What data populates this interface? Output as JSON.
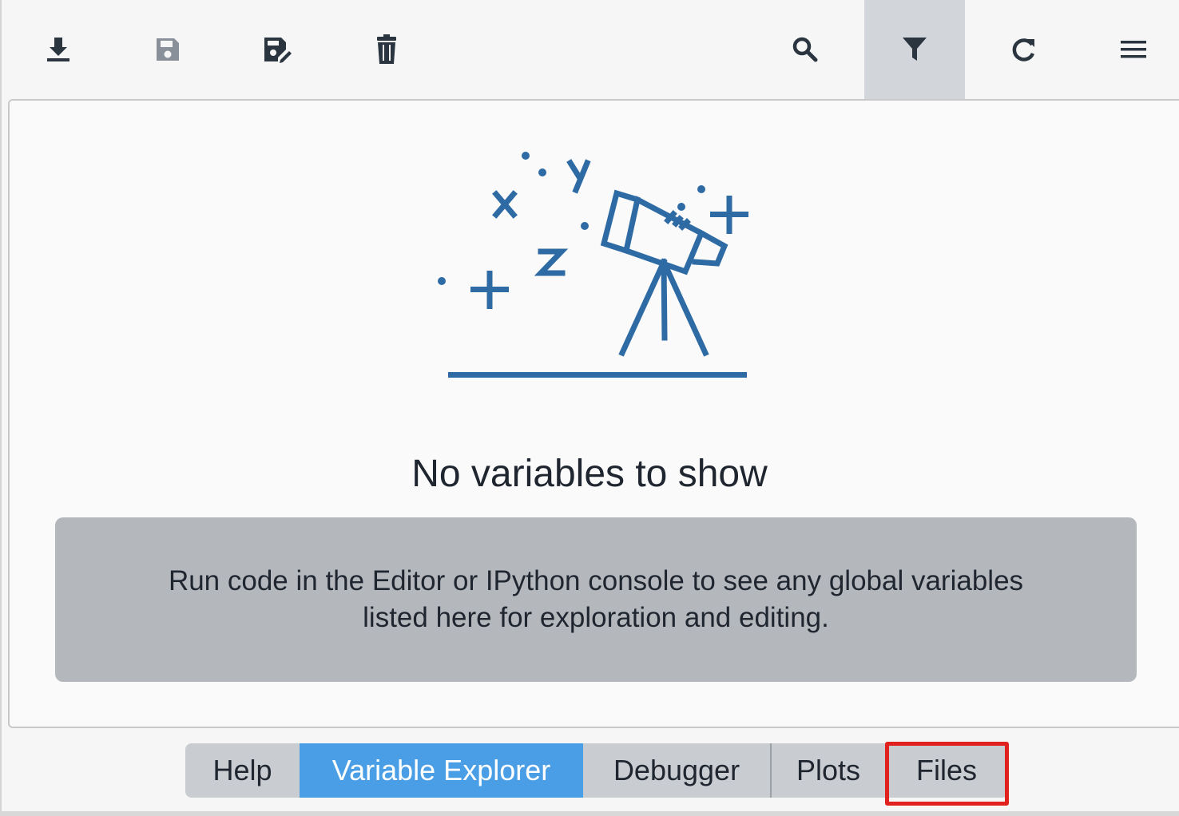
{
  "toolbar": {
    "buttons": [
      {
        "name": "import-data",
        "icon": "download-icon"
      },
      {
        "name": "save-data",
        "icon": "save-icon",
        "disabled": true
      },
      {
        "name": "save-data-as",
        "icon": "save-as-icon"
      },
      {
        "name": "remove-all-variables",
        "icon": "trash-icon"
      },
      {
        "name": "search-variables",
        "icon": "search-icon"
      },
      {
        "name": "filter-variables",
        "icon": "filter-icon",
        "active": true
      },
      {
        "name": "refresh-variables",
        "icon": "refresh-icon"
      },
      {
        "name": "options-menu",
        "icon": "hamburger-menu-icon"
      }
    ]
  },
  "empty_state": {
    "illustration": "telescope-icon",
    "title": "No variables to show",
    "message_line1": "Run code in the Editor or IPython console to see any global variables",
    "message_line2": "listed here for exploration and editing."
  },
  "tabs": [
    {
      "label": "Help"
    },
    {
      "label": "Variable Explorer",
      "selected": true
    },
    {
      "label": "Debugger"
    },
    {
      "label": "Plots"
    },
    {
      "label": "Files",
      "highlighted": true
    }
  ],
  "colors": {
    "icon": "#2b3540",
    "icon_disabled": "#8a9099",
    "illustration": "#2e6aa3",
    "tab_selected": "#4a9ee6",
    "highlight": "#e0211d"
  }
}
